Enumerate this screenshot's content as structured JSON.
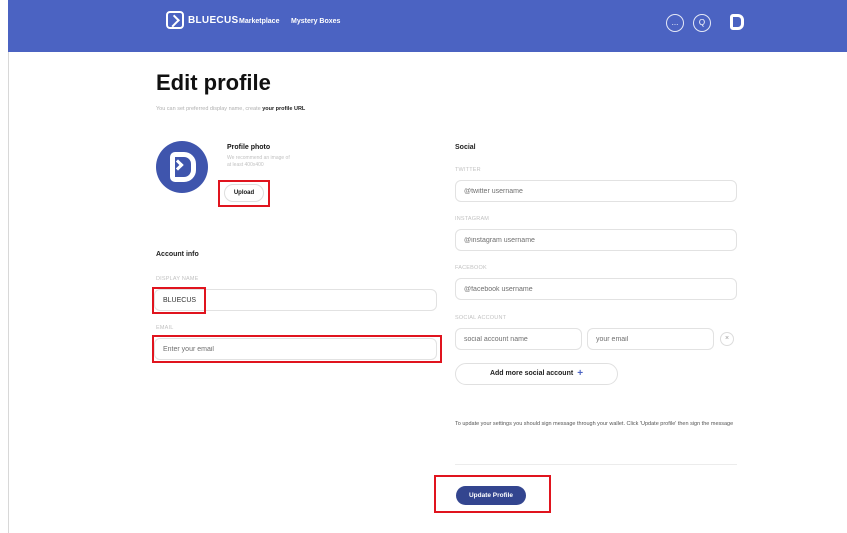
{
  "header": {
    "brand": "BLUECUS",
    "nav": [
      {
        "label": "Marketplace"
      },
      {
        "label": "Mystery Boxes"
      }
    ],
    "more_icon": "...",
    "search_icon": "Q"
  },
  "page": {
    "title": "Edit profile",
    "subtitle_prefix": "You can set preferred display name, create ",
    "subtitle_link": "your profile URL"
  },
  "profile_photo": {
    "label": "Profile photo",
    "hint": "We recommend an image of at least 400x400",
    "upload_label": "Upload"
  },
  "account_info": {
    "heading": "Account info",
    "display_name_label": "DISPLAY NAME",
    "display_name_value": "BLUECUS",
    "email_label": "EMAIL",
    "email_placeholder": "Enter your email"
  },
  "social": {
    "heading": "Social",
    "twitter_label": "TWITTER",
    "twitter_placeholder": "@twitter username",
    "instagram_label": "INSTAGRAM",
    "instagram_placeholder": "@instagram username",
    "facebook_label": "FACEBOOK",
    "facebook_placeholder": "@facebook username",
    "social_account_label": "SOCIAL ACCOUNT",
    "social_name_placeholder": "social account name",
    "social_email_placeholder": "your email",
    "clear_icon": "×",
    "add_more_label": "Add more social account",
    "add_more_icon": "+"
  },
  "notice": "To update your settings you should sign message through your wallet. Click 'Update profile' then sign the message",
  "update_button": "Update Profile",
  "colors": {
    "header": "#4b63c2",
    "primary_button": "#33458f",
    "highlight": "#e0141e"
  }
}
